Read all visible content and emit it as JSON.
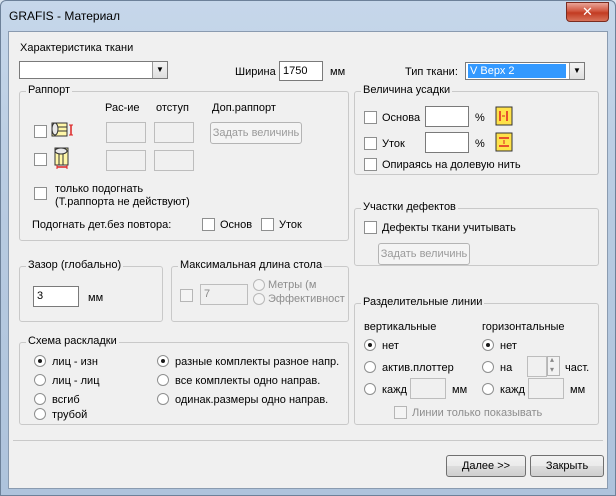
{
  "window": {
    "title": "GRAFIS - Материал",
    "close_glyph": "✕"
  },
  "fabric": {
    "label": "Характеристика ткани",
    "value": "",
    "width_label": "Ширина",
    "width_value": "1750",
    "width_unit": "мм",
    "type_label": "Тип ткани:",
    "type_value": "V Верх 2"
  },
  "rapport": {
    "title": "Раппорт",
    "col_rasie": "Рас-ие",
    "col_otstup": "отступ",
    "col_dop": "Доп.раппорт",
    "set_button": "Задать величинь",
    "only_fit_line1": "только подогнать",
    "only_fit_line2": "(Т.раппорта не действуют)",
    "fit_label": "Подогнать дет.без повтора:",
    "osnov_label": "Основ",
    "utok_label": "Уток"
  },
  "shrink": {
    "title": "Величина усадки",
    "osnova_label": "Основа",
    "utok_label": "Уток",
    "percent": "%",
    "grain_label": "Опираясь на долевую нить"
  },
  "defects": {
    "title": "Участки дефектов",
    "check_label": "Дефекты ткани учитывать",
    "set_button": "Задать величинь"
  },
  "gap": {
    "title": "Зазор (глобально)",
    "value": "3",
    "unit": "мм"
  },
  "table": {
    "title": "Максимальная длина стола",
    "value": "7",
    "meters": "Метры (м",
    "efficiency": "Эффективност"
  },
  "scheme": {
    "title": "Схема раскладки",
    "left": [
      "лиц - изн",
      "лиц - лиц",
      "всгиб",
      "трубой"
    ],
    "right": [
      "разные комплекты разное напр.",
      "все комплекты одно направ.",
      "одинак.размеры одно направ."
    ]
  },
  "lines": {
    "title": "Разделительные линии",
    "vertical": "вертикальные",
    "horizontal": "горизонтальные",
    "none": "нет",
    "plotter": "актив.плоттер",
    "every": "кажд",
    "on": "на",
    "parts": "част.",
    "mm": "мм",
    "show_only": "Линии только показывать"
  },
  "footer": {
    "next": "Далее >>",
    "close": "Закрыть"
  },
  "icons": {
    "dropdown": "▼",
    "plus": "+"
  }
}
